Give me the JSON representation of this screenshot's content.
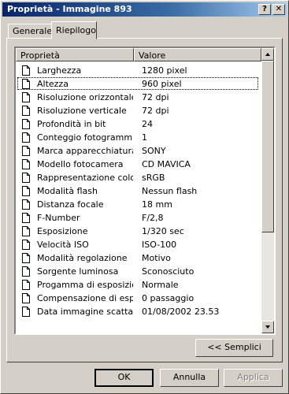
{
  "window": {
    "title": "Proprietà - Immagine 893",
    "help_glyph": "?",
    "close_glyph": "✕"
  },
  "tabs": [
    {
      "label": "Generale",
      "active": false
    },
    {
      "label": "Riepilogo",
      "active": true
    }
  ],
  "list": {
    "col_property": "Proprietà",
    "col_value": "Valore",
    "rows": [
      {
        "name": "Larghezza",
        "value": "1280 pixel"
      },
      {
        "name": "Altezza",
        "value": "960 pixel"
      },
      {
        "name": "Risoluzione orizzontale",
        "value": "72 dpi"
      },
      {
        "name": "Risoluzione verticale",
        "value": "72 dpi"
      },
      {
        "name": "Profondità in bit",
        "value": "24"
      },
      {
        "name": "Conteggio fotogrammi",
        "value": "1"
      },
      {
        "name": "Marca apparecchiatura",
        "value": "SONY"
      },
      {
        "name": "Modello fotocamera",
        "value": "CD MAVICA"
      },
      {
        "name": "Rappresentazione colore",
        "value": "sRGB"
      },
      {
        "name": "Modalità flash",
        "value": "Nessun flash"
      },
      {
        "name": "Distanza focale",
        "value": "18 mm"
      },
      {
        "name": "F-Number",
        "value": "F/2,8"
      },
      {
        "name": "Esposizione",
        "value": "1/320 sec"
      },
      {
        "name": "Velocità ISO",
        "value": "ISO-100"
      },
      {
        "name": "Modalità regolazione",
        "value": "Motivo"
      },
      {
        "name": "Sorgente luminosa",
        "value": "Sconosciuto"
      },
      {
        "name": "Progamma di esposizione",
        "value": "Normale"
      },
      {
        "name": "Compensazione di espo...",
        "value": "0 passaggio"
      },
      {
        "name": "Data immagine scattata",
        "value": "01/08/2002 23.53"
      }
    ]
  },
  "buttons": {
    "simple": "<< Semplici",
    "ok": "OK",
    "cancel": "Annulla",
    "apply": "Applica"
  },
  "colors": {
    "title_start": "#0a246a",
    "title_end": "#a6caf0",
    "face": "#d4d0c8"
  }
}
